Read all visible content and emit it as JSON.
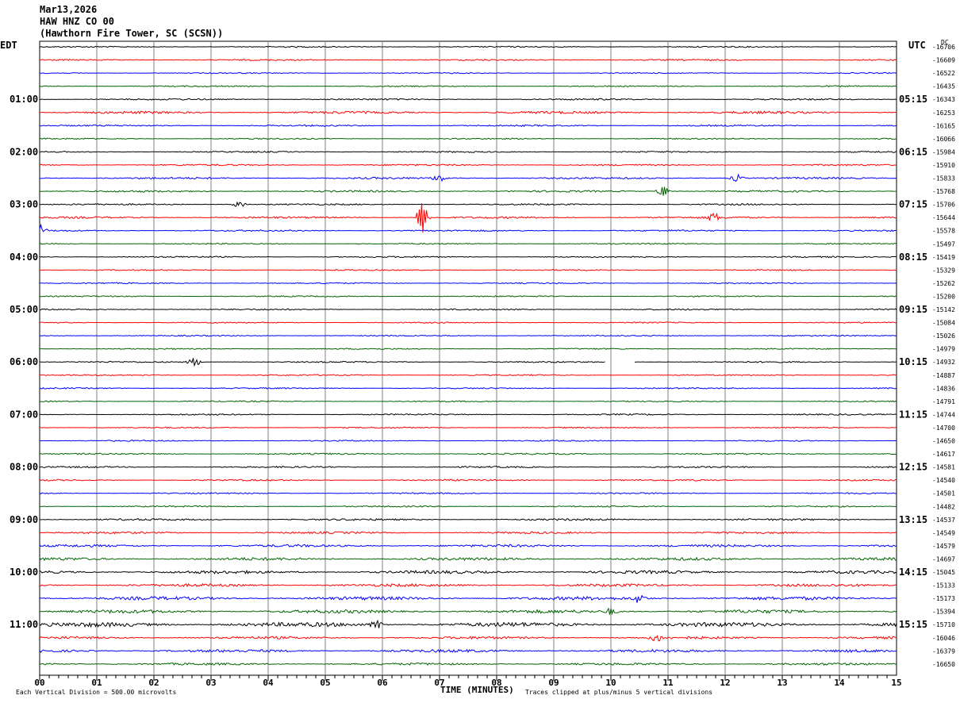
{
  "header": {
    "date": "Mar13,2026",
    "channel": "HAW HNZ CO 00",
    "station": "(Hawthorn Fire Tower, SC (SCSN))"
  },
  "left_tz": "EDT",
  "right_tz": "UTC",
  "dc_label": "DC",
  "footer": {
    "scale": "Each Vertical Division =  500.00 microvolts",
    "xlabel": "TIME (MINUTES)",
    "clip_note": "Traces clipped at plus/minus 5 vertical divisions"
  },
  "colors": {
    "trace_cycle": [
      "#000000",
      "#ff0000",
      "#0000ff",
      "#006400"
    ],
    "grid": "#808080"
  },
  "chart_data": {
    "type": "line",
    "title": "",
    "xlabel": "TIME (MINUTES)",
    "xlim": [
      0,
      15
    ],
    "x_ticks": [
      "00",
      "01",
      "02",
      "03",
      "04",
      "05",
      "06",
      "07",
      "08",
      "09",
      "10",
      "11",
      "12",
      "13",
      "14",
      "15"
    ],
    "left_hour_labels": [
      "01:00",
      "02:00",
      "03:00",
      "04:00",
      "05:00",
      "06:00",
      "07:00",
      "08:00",
      "09:00",
      "10:00",
      "11:00"
    ],
    "right_hour_labels": [
      "05:15",
      "06:15",
      "07:15",
      "08:15",
      "09:15",
      "10:15",
      "11:15",
      "12:15",
      "13:15",
      "14:15",
      "15:15"
    ],
    "dc_offsets": [
      "-16706",
      "-16609",
      "-16522",
      "-16435",
      "-16343",
      "-16253",
      "-16165",
      "-16066",
      "-15984",
      "-15910",
      "-15833",
      "-15768",
      "-15706",
      "-15644",
      "-15578",
      "-15497",
      "-15419",
      "-15329",
      "-15262",
      "-15200",
      "-15142",
      "-15084",
      "-15026",
      "-14979",
      "-14932",
      "-14887",
      "-14836",
      "-14791",
      "-14744",
      "-14700",
      "-14650",
      "-14617",
      "-14581",
      "-14540",
      "-14501",
      "-14482",
      "-14537",
      "-14549",
      "-14579",
      "-14697",
      "-15045",
      "-15133",
      "-15173",
      "-15394",
      "-15710",
      "-16046",
      "-16379",
      "-16650"
    ],
    "trace_noise": [
      0.8,
      0.9,
      0.7,
      0.8,
      1.0,
      1.6,
      1.0,
      0.8,
      0.9,
      1.0,
      1.2,
      1.2,
      1.0,
      1.2,
      1.0,
      0.8,
      0.9,
      0.8,
      0.8,
      0.8,
      0.9,
      0.8,
      0.8,
      0.8,
      0.9,
      0.8,
      0.8,
      0.8,
      0.9,
      0.8,
      0.8,
      1.0,
      1.0,
      1.0,
      0.9,
      0.9,
      1.2,
      1.3,
      1.6,
      1.8,
      2.0,
      1.8,
      2.2,
      2.2,
      2.8,
      1.6,
      1.8,
      1.4
    ],
    "events": [
      {
        "row": 10,
        "minute": 7.0,
        "amp": 6
      },
      {
        "row": 10,
        "minute": 12.2,
        "amp": 5
      },
      {
        "row": 11,
        "minute": 10.9,
        "amp": 8
      },
      {
        "row": 12,
        "minute": 3.5,
        "amp": 5
      },
      {
        "row": 13,
        "minute": 6.7,
        "amp": 22
      },
      {
        "row": 13,
        "minute": 11.8,
        "amp": 6
      },
      {
        "row": 14,
        "minute": 0.0,
        "amp": 8
      },
      {
        "row": 24,
        "minute": 2.7,
        "amp": 6
      },
      {
        "row": 42,
        "minute": 10.5,
        "amp": 6
      },
      {
        "row": 43,
        "minute": 10.0,
        "amp": 4
      },
      {
        "row": 44,
        "minute": 5.9,
        "amp": 6
      },
      {
        "row": 45,
        "minute": 10.8,
        "amp": 5
      }
    ],
    "gap": {
      "row": 24,
      "from_minute": 9.9,
      "to_minute": 10.4
    }
  }
}
